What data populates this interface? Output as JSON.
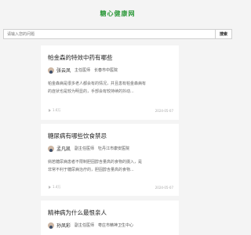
{
  "site": {
    "logo": "糖心健康网"
  },
  "search": {
    "placeholder": "请输入您的问题",
    "button_label": "搜索"
  },
  "articles": [
    {
      "title": "帕金森的特效中药有哪些",
      "author": {
        "name": "张云凤",
        "title": "主任医师",
        "hospital": "长春市中医院"
      },
      "excerpt_lines": [
        "帕金森病是很多老人都会有的情况，并且患有帕金森病有",
        "的症状也是较为明显的，手部会有较持续的抖动..."
      ],
      "views": "1.6万",
      "date": "2024-05-07"
    },
    {
      "title": "糖尿病有哪些饮食禁忌",
      "author": {
        "name": "孟凡凯",
        "title": "副主任医师",
        "hospital": "牡丹江市康安医院"
      },
      "excerpt_lines": [
        "倘若糖尿病患者不限制胆固醇含量高的食物的摄入，是",
        "非常不利于糖尿病治疗的，胆固醇含量高的食物..."
      ],
      "views": "1.4万",
      "date": "2024-05-07"
    },
    {
      "title": "精神病为什么最恨亲人",
      "author": {
        "name": "孙凤彩",
        "title": "副主任医师",
        "hospital": "枣庄市精神卫生中心"
      }
    }
  ]
}
